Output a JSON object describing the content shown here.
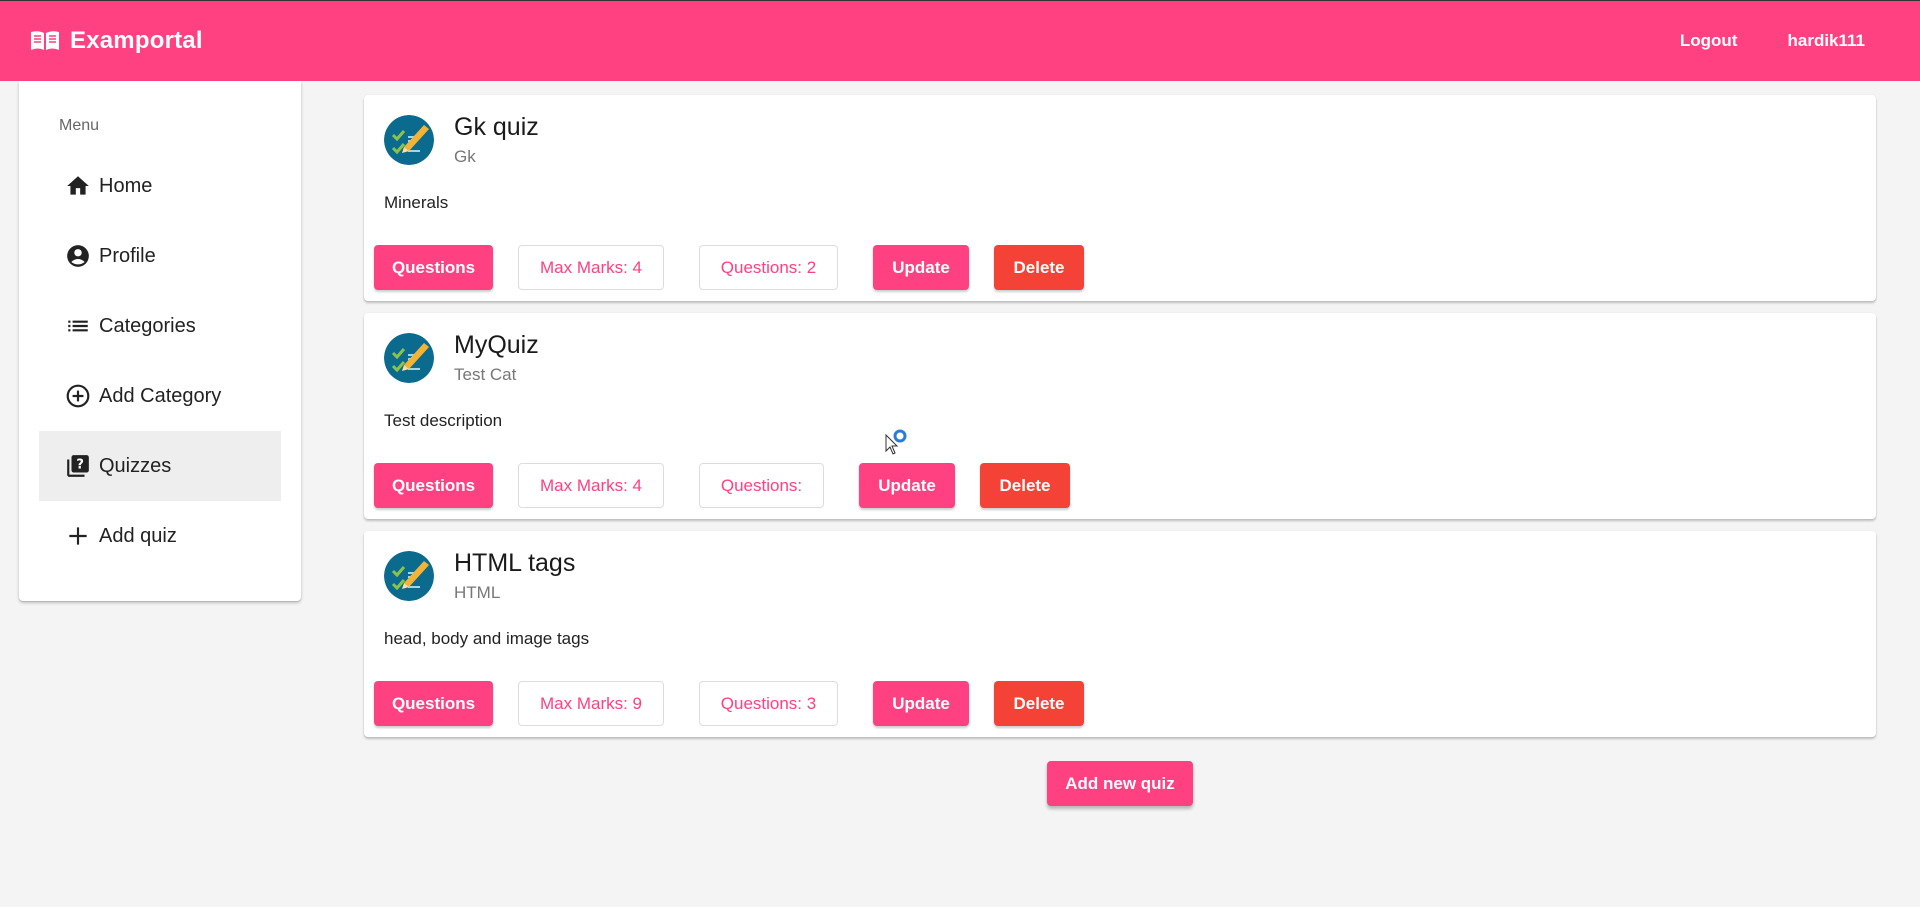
{
  "header": {
    "brand": "Examportal",
    "brand_icon": "book-open-icon",
    "logout_label": "Logout",
    "username": "hardik111",
    "bg_color": "#ff4081"
  },
  "sidebar": {
    "menu_label": "Menu",
    "items": [
      {
        "label": "Home",
        "icon": "home-icon"
      },
      {
        "label": "Profile",
        "icon": "account-circle-icon"
      },
      {
        "label": "Categories",
        "icon": "list-icon"
      },
      {
        "label": "Add Category",
        "icon": "add-circle-outline-icon"
      },
      {
        "label": "Quizzes",
        "icon": "quiz-icon",
        "active": true
      },
      {
        "label": "Add quiz",
        "icon": "plus-icon"
      }
    ]
  },
  "quizzes": [
    {
      "title": "Gk quiz",
      "category": "Gk",
      "description": "Minerals",
      "questions_btn": "Questions",
      "max_marks": "Max Marks: 4",
      "questions_count": "Questions: 2",
      "update_btn": "Update",
      "delete_btn": "Delete"
    },
    {
      "title": "MyQuiz",
      "category": "Test Cat",
      "description": "Test description",
      "questions_btn": "Questions",
      "max_marks": "Max Marks: 4",
      "questions_count": "Questions:",
      "update_btn": "Update",
      "delete_btn": "Delete"
    },
    {
      "title": "HTML tags",
      "category": "HTML",
      "description": "head, body and image tags",
      "questions_btn": "Questions",
      "max_marks": "Max Marks: 9",
      "questions_count": "Questions: 3",
      "update_btn": "Update",
      "delete_btn": "Delete"
    }
  ],
  "add_new_quiz_label": "Add new quiz",
  "colors": {
    "primary": "#ff4081",
    "warn": "#f44336",
    "background": "#f4f4f4"
  }
}
